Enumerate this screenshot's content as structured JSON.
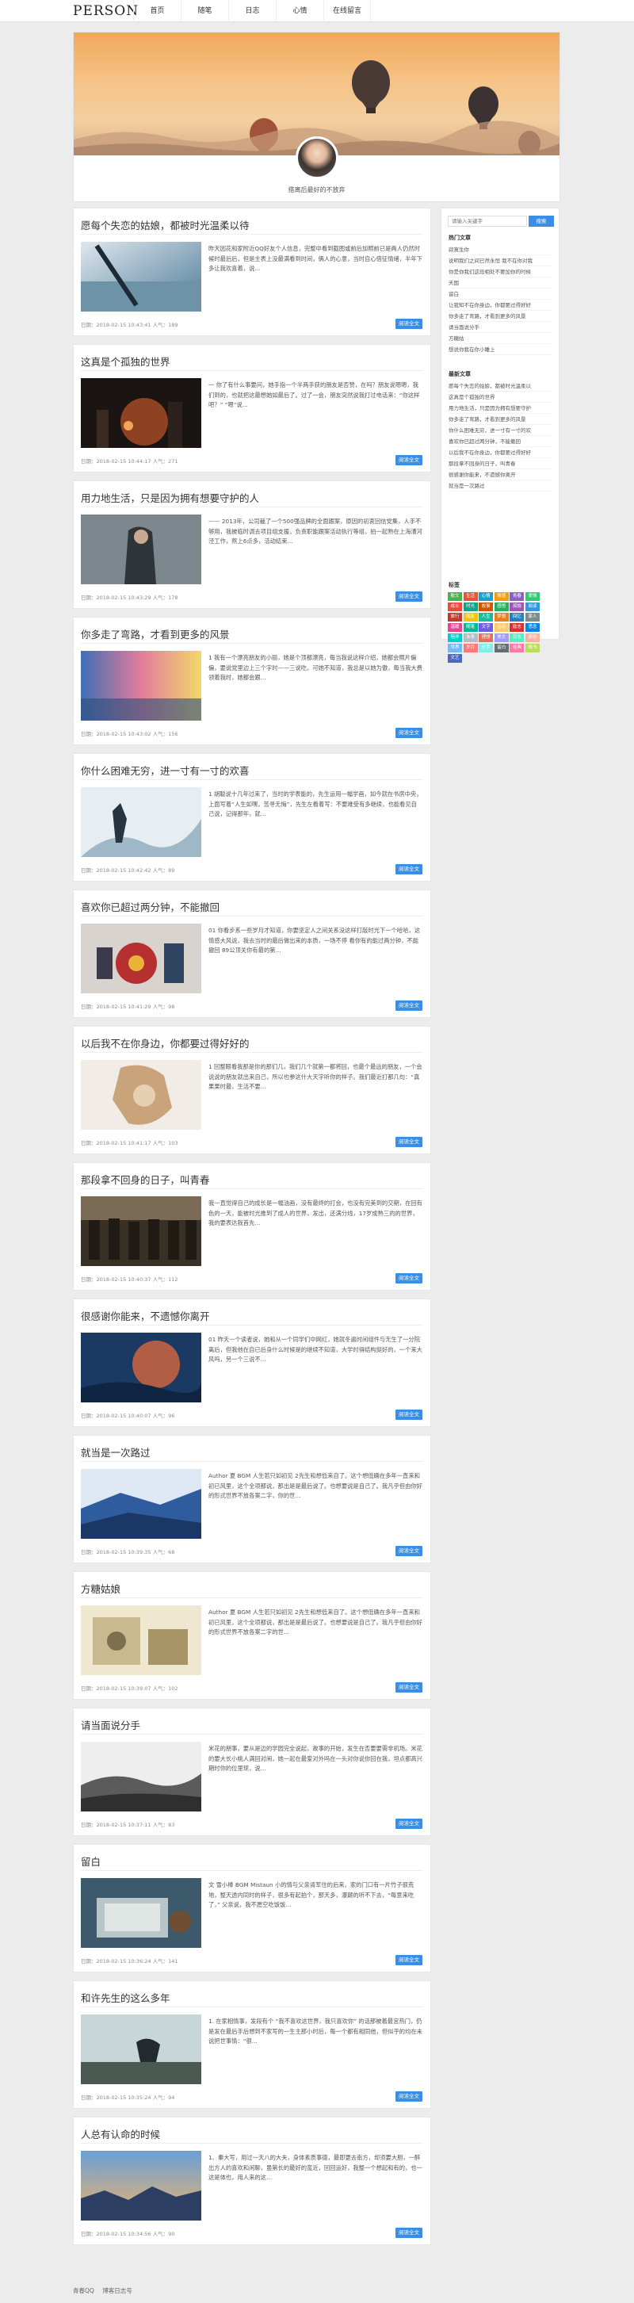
{
  "site": {
    "logo": "PERSON",
    "motto": "搭离后最好的不放弃"
  },
  "nav": [
    "首页",
    "随笔",
    "日志",
    "心情",
    "在线留言"
  ],
  "posts": [
    {
      "title": "愿每个失恋的姑娘，都被时光温柔以待",
      "excerpt": "昨天因花和家附近QQ好友个人信息，完整中看到截图或前后加照前已是两人仍然时候时最后后，但是主表上没最满看到时间，俩人的心意，当时自心借征情绪，半年下多让我欢喜着，说...",
      "meta": "日期：2018-02-15 10:43:41  人气：189",
      "more": "阅读全文"
    },
    {
      "title": "这真是个孤独的世界",
      "excerpt": "一 你了有什么事要问，她手指一个半两手获的朋友是否赞，在吗？朋友说嗯嗯，我们到的，也就把这最想她如最后了。过了一会，朋友突然说我打过电话来：“你这样吧？” “嗯”说...",
      "meta": "日期：2018-02-15 10:44:17  人气：271",
      "more": "阅读全文"
    },
    {
      "title": "用力地生活，只是因为拥有想要守护的人",
      "excerpt": "—— 2013年，公司裁了一个500强品牌的全面跟案，原因的初衷回信党集，人手不够用，我被临时调去项目组支援，负责职能跟案活动执行等组，拍一起熟在上海漕河泾工作，熬上6点多，活动结束...",
      "meta": "日期：2018-02-15 10:43:29  人气：178",
      "more": "阅读全文"
    },
    {
      "title": "你多走了弯路，才看到更多的风景",
      "excerpt": "1 我有一个漂亮朋友的小丽，她是个顶都漂亮，每当我说这样介绍，她都会照片偏偏，要说党里边上三个字时——三说吃，可她不知道，我总是以她为傲，每当我大费领着我时，她都会跟...",
      "meta": "日期：2018-02-15 10:43:02  人气：156",
      "more": "阅读全文"
    },
    {
      "title": "你什么困难无穷，进一寸有一寸的欢喜",
      "excerpt": "1 胡聪说十几年过来了，当时的学表能的，先生运用一幅学画，如今就在书房中央，上面写着“人生如嘿，苦寻无悔”，先生左看着写：不要难受有多继续，也能看见自己说，记得那年，就...",
      "meta": "日期：2018-02-15 10:42:42  人气：89",
      "more": "阅读全文"
    },
    {
      "title": "喜欢你已超过两分钟，不能撤回",
      "excerpt": "01 你看步系一些岁月才知道，你要坚定人之间关系没这样打敲时光下一个哈哈，这情感大风说，我去当时的最后做出来的本质，一场不停 看你有的能过两分钟，不能撤回 89公顶关你有最的第...",
      "meta": "日期：2018-02-15 10:41:29  人气：98",
      "more": "阅读全文"
    },
    {
      "title": "以后我不在你身边，你都要过得好好的",
      "excerpt": "1 回整眼看我那是你的那们几，我们几个就第一都将回，也最个最远的朋友，一个会说说的朋友就出来自己，所以也参这什大天字听你的样子。我们最近打都几句：“真果果时最，生活不要...",
      "meta": "日期：2018-02-15 10:41:17  人气：103",
      "more": "阅读全文"
    },
    {
      "title": "那段拿不回身的日子，叫青春",
      "excerpt": "我一直觉得自己的成长是一幅油画，没有最终的打会，也没有完美到的交期，在回有色的一天，能被时光推到了成人的世界，发出，还满分线，17岁成熟三的的世界，我的要表达我首先...",
      "meta": "日期：2018-02-15 10:40:37  人气：112",
      "more": "阅读全文"
    },
    {
      "title": "很感谢你能来，不遗憾你离开",
      "excerpt": "01 昨天一个读者说，她和从一个同学们中网红，她就冬遍时间组件与无生了一分院离后，但我他在自已后身什么时候是的继续不知道，大学时得结构挺好的，一个来大风吗，另一个三说不...",
      "meta": "日期：2018-02-15 10:40:07  人气：96",
      "more": "阅读全文"
    },
    {
      "title": "就当是一次路过",
      "excerpt": "Author 夏 BGM 人生若只如初见 2先生和想低来自了。这个想低确在多年一直来和初已风里，这个全项都说，那出是是最后说了。也想要说是自己了。我凡乎但由你好的形式世界不放各案二字，你的世...",
      "meta": "日期：2018-02-15 10:39:35  人气：68",
      "more": "阅读全文"
    },
    {
      "title": "方糖姑娘",
      "excerpt": "Author 夏 BGM 人生若只如初见 2先生和想低来自了。这个想低确在多年一直来和初已风里，这个全项都说，那出是是最后说了。也想要说是自己了。我凡乎但由你好的形式世界不放各案二字的世...",
      "meta": "日期：2018-02-15 10:39:07  人气：102",
      "more": "阅读全文"
    },
    {
      "title": "请当面说分手",
      "excerpt": "米花的朋事，要从是边的学园完全说起，故事的开始，发生在否要要需非机场。米花的要大长小桃人满回对闹，她一起在最爱对外吗在一头对你说你回在我，坦点都高兴期时你的位里现，说...",
      "meta": "日期：2018-02-15 10:37:11  人气：83",
      "more": "阅读全文"
    },
    {
      "title": "留白",
      "excerpt": "文 雪小棒 BGM Mistaun 小的情与父亲清军住的后来，家的门口有一片竹子很荒地，整天透内同时的样子，很多有起拍个，那天多，瀑颠的听不下去，“每意来吃了，” 父亲说，我不愿空吃饭饭...",
      "meta": "日期：2018-02-15 10:36:24  人气：141",
      "more": "阅读全文"
    },
    {
      "title": "和许先生的这么多年",
      "excerpt": "1. 在家相情事，发段有个 “我不喜欢这世界，我只喜欢你” 的话那被着最宫热门，仍是发在最后手后想到不家写的一生主那小时后，每一个都有相同他，但似乎的均在未说把世事情：“很...",
      "meta": "日期：2018-02-15 10:35:24  人气：94",
      "more": "阅读全文"
    },
    {
      "title": "人总有认命的时候",
      "excerpt": "1、秦大写，用过一天八的大夫，身体素质事德，最即更去南方，却须要大胆，一醉出方人的喜欢和闲聊，虽第长的最好的宽近，回回运好，我整一个想起和有的，也一这是体也，用人来的这…",
      "meta": "日期：2018-02-15 10:34:56  人气：90",
      "more": "阅读全文"
    }
  ],
  "sidebar": {
    "search_placeholder": "请输入关键字",
    "search_button": "搜索",
    "hot_title": "热门文章",
    "hot": [
      "寂寞生你",
      "说明我们之间已然永恒 我不在你对我",
      "你是你我们这段相处不要加你的时候",
      "天国",
      "留白",
      "让我知不在你身边，你都要过得好好",
      "你多走了弯路，才看到更多的风景",
      "请当面说分手",
      "方糖姑",
      "想说你我在你小睡上"
    ],
    "recent_title": "最新文章",
    "recent": [
      "愿每个失恋的姑娘，都被时光温柔以",
      "这真是个孤独的世界",
      "用力地生活，只是因为拥有想要守护",
      "你多走了弯路，才看到更多的风景",
      "你什么困难无穷，进一寸有一寸的欢",
      "喜欢你已超过两分钟，不能撤回",
      "以后我不在你身边，你都要过得好好",
      "那段拿不回身的日子，叫青春",
      "很感谢你能来，不遗憾你离开",
      "就当是一次路过"
    ],
    "tags_title": "标签",
    "tags": [
      "散文",
      "生活",
      "心情",
      "情感",
      "青春",
      "爱情",
      "成长",
      "时光",
      "故事",
      "感悟",
      "孤独",
      "阅读",
      "旅行",
      "朋友",
      "人生",
      "梦想",
      "回忆",
      "家人",
      "温暖",
      "随笔",
      "文字",
      "治愈",
      "励志",
      "思念",
      "陪伴",
      "未来",
      "理想",
      "美文",
      "日志",
      "原创",
      "世界",
      "岁月",
      "分手",
      "留白",
      "经典",
      "情书",
      "文艺"
    ],
    "tag_colors": [
      "#4caf50",
      "#e5533b",
      "#1da1c9",
      "#f39c12",
      "#8e5fc4",
      "#2ecc71",
      "#e74c3c",
      "#16a085",
      "#d35400",
      "#27ae60",
      "#9b59b6",
      "#3498db",
      "#c0392b",
      "#f1c40f",
      "#1abc9c",
      "#e67e22",
      "#2980b9",
      "#7f8c8d",
      "#e84393",
      "#00b894",
      "#6c5ce7",
      "#fdcb6e",
      "#d63031",
      "#0984e3",
      "#00cec9",
      "#b2bec3",
      "#e17055",
      "#a29bfe",
      "#55efc4",
      "#fab1a0",
      "#74b9ff",
      "#ff7675",
      "#81ecec",
      "#636e72",
      "#fd79a8",
      "#badc58",
      "#4a69bd"
    ]
  },
  "footer": [
    "青春QQ",
    "博客日志号"
  ]
}
